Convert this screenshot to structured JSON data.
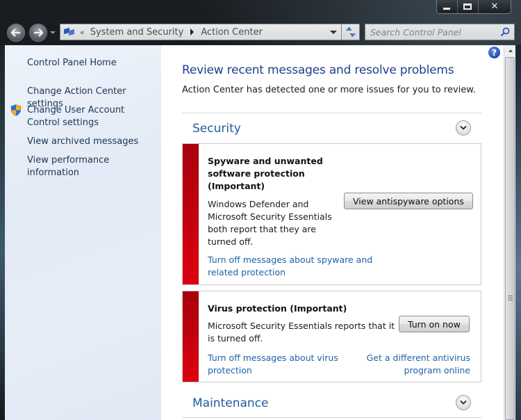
{
  "window": {
    "caption": {
      "minimize": "minimize",
      "maximize": "maximize",
      "close": "✕"
    }
  },
  "navigation": {
    "back_icon": "◀",
    "forward_icon": "▶",
    "breadcrumb": {
      "overflow": "«",
      "items": [
        "System and Security",
        "Action Center"
      ]
    },
    "refresh_icon": "↺",
    "search": {
      "value": "",
      "placeholder": "Search Control Panel"
    }
  },
  "sidebar": {
    "items": [
      {
        "label": "Control Panel Home"
      },
      {
        "label": "Change Action Center settings"
      },
      {
        "label": "Change User Account Control settings",
        "icon": "uac-shield-icon"
      },
      {
        "label": "View archived messages"
      },
      {
        "label": "View performance information"
      }
    ]
  },
  "main": {
    "help_icon": "?",
    "title": "Review recent messages and resolve problems",
    "description": "Action Center has detected one or more issues for you to review.",
    "sections": [
      {
        "title": "Security",
        "alerts": [
          {
            "title": "Spyware and unwanted software protection (Important)",
            "body": "Windows Defender and Microsoft Security Essentials both report that they are turned off.",
            "button": "View antispyware options",
            "links": [
              "Turn off messages about spyware and related protection"
            ],
            "severity_color": "#c1000e"
          },
          {
            "title": "Virus protection  (Important)",
            "body": "Microsoft Security Essentials reports that it is turned off.",
            "button": "Turn on now",
            "links": [
              "Turn off messages about virus protection",
              "Get a different antivirus program online"
            ],
            "severity_color": "#c1000e"
          }
        ]
      },
      {
        "title": "Maintenance",
        "alerts": []
      }
    ]
  },
  "colors": {
    "link": "#1f62a8",
    "heading": "#1e3e8a",
    "section_heading": "#1f5c9b",
    "alert_red": "#c1000e"
  }
}
